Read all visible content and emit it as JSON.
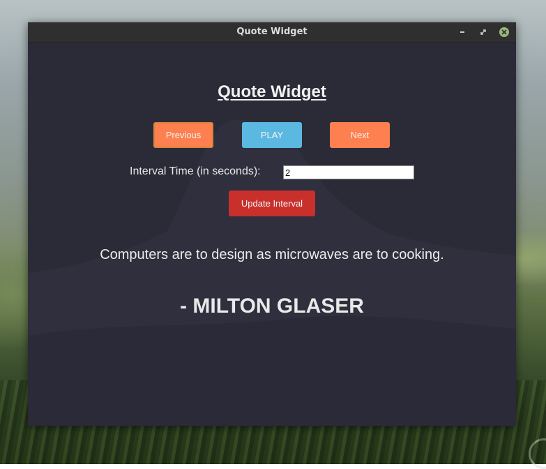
{
  "window": {
    "title": "Quote Widget",
    "controls": {
      "minimize_icon": "minimize-icon",
      "maximize_icon": "maximize-icon",
      "close_icon": "close-icon"
    }
  },
  "app": {
    "heading": "Quote Widget",
    "buttons": {
      "previous": "Previous",
      "play": "PLAY",
      "next": "Next",
      "update_interval": "Update Interval"
    },
    "interval": {
      "label": "Interval Time (in seconds):",
      "value": "2"
    },
    "quote": {
      "text": "Computers are to design as microwaves are to cooking.",
      "author": "- MILTON GLASER"
    }
  },
  "colors": {
    "previous_bg": "#fe7f4f",
    "play_bg": "#5bb8e0",
    "next_bg": "#fe7f4f",
    "update_bg": "#c9302c",
    "window_bg": "#2b2b37",
    "titlebar_bg": "#2f2f2f",
    "close_button": "#9ab87a"
  }
}
